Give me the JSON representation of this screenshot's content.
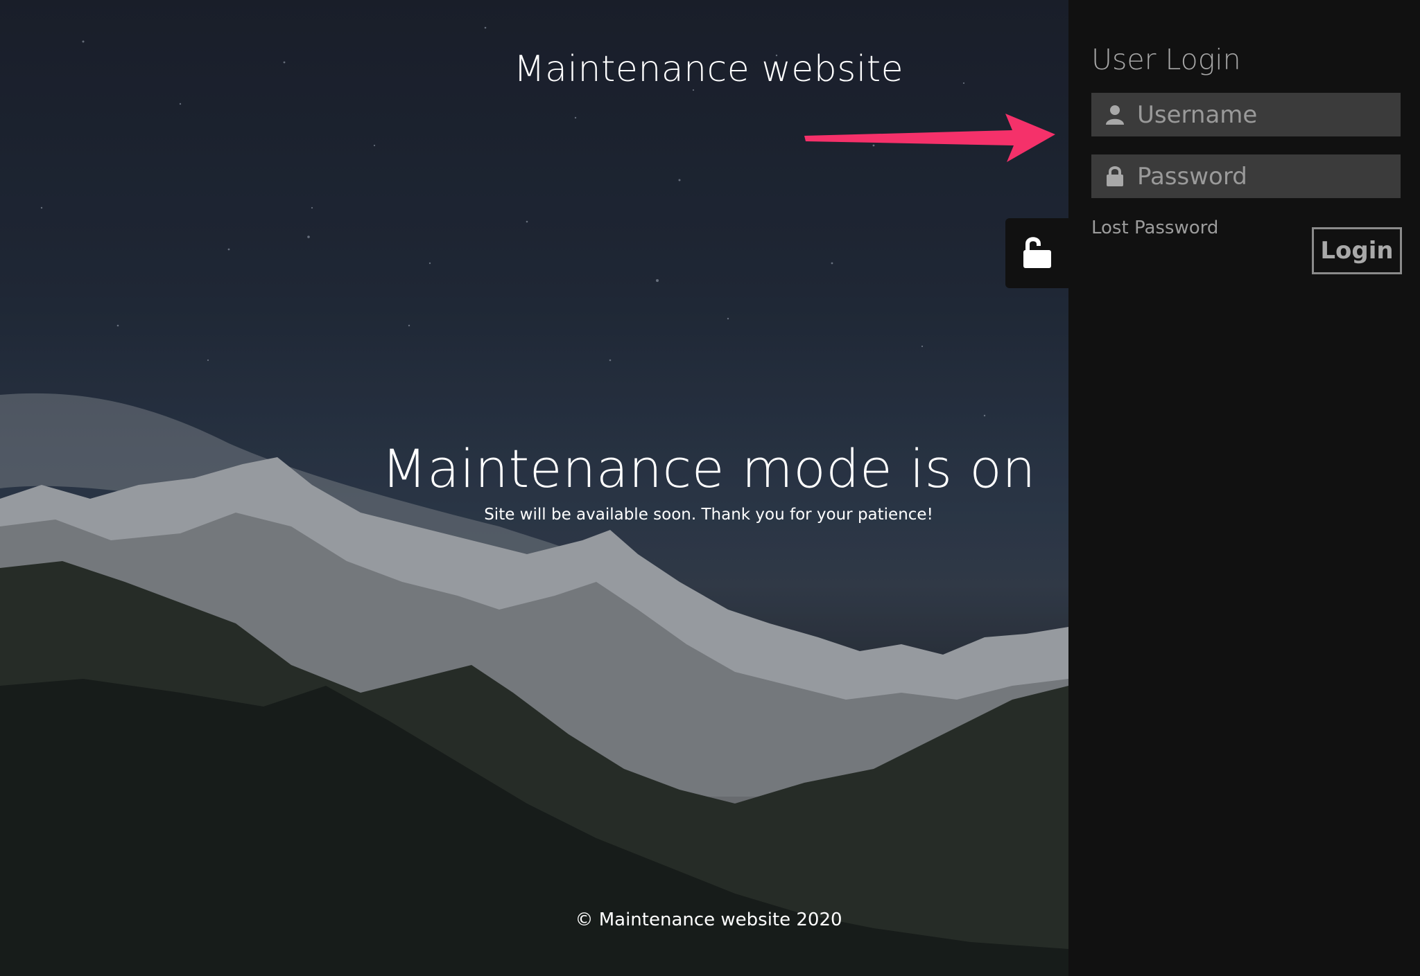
{
  "site": {
    "title": "Maintenance website",
    "headline": "Maintenance mode is on",
    "subline": "Site will be available soon. Thank you for your patience!",
    "footer": "© Maintenance website 2020"
  },
  "login_panel": {
    "title": "User Login",
    "username": {
      "placeholder": "Username",
      "value": "",
      "icon": "user-icon"
    },
    "password": {
      "placeholder": "Password",
      "value": "",
      "icon": "lock-icon"
    },
    "lost_password_label": "Lost Password",
    "login_label": "Login",
    "toggle_icon": "unlock-icon"
  },
  "annotation": {
    "arrow_color": "#f5316a"
  },
  "colors": {
    "panel_bg": "#111111",
    "field_bg": "#3b3b3b",
    "text_muted": "#a7a7a7"
  }
}
